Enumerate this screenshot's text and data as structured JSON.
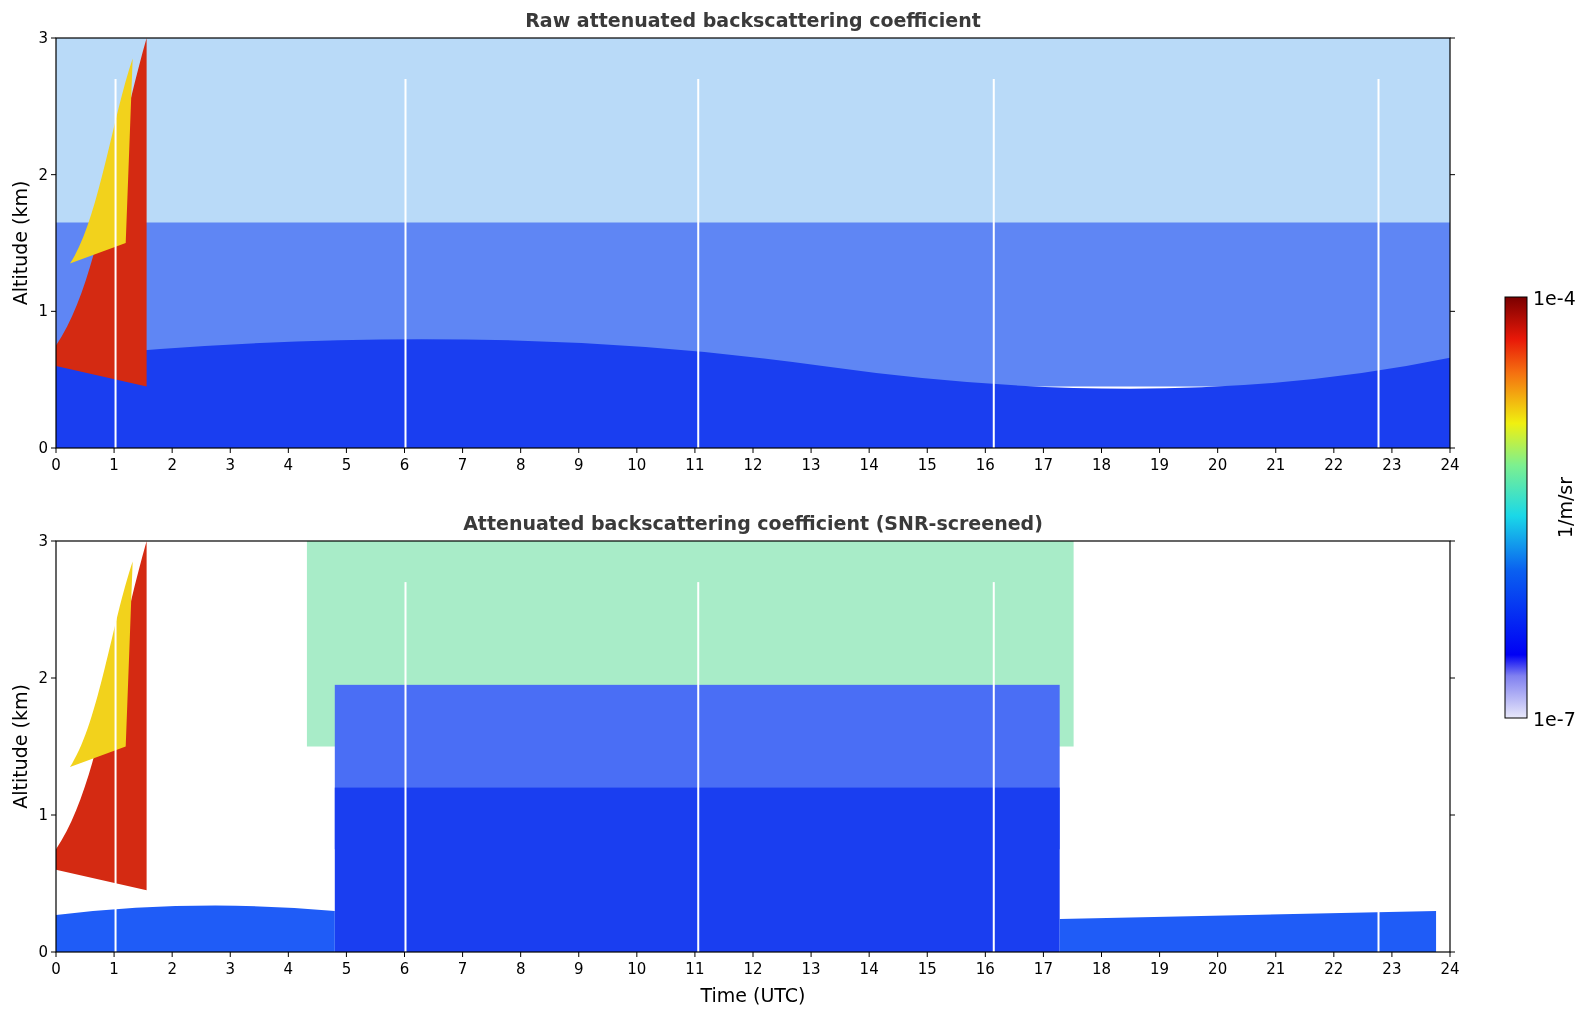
{
  "panels": [
    {
      "title": "Raw attenuated backscattering coefficient",
      "ylabel": "Altitude (km)",
      "yticks": [
        "3",
        "2",
        "1",
        "0"
      ],
      "xticks": [
        "0",
        "1",
        "2",
        "3",
        "4",
        "5",
        "6",
        "7",
        "8",
        "9",
        "10",
        "11",
        "12",
        "13",
        "14",
        "15",
        "16",
        "17",
        "18",
        "19",
        "20",
        "21",
        "22",
        "23",
        "24"
      ]
    },
    {
      "title": "Attenuated backscattering coefficient (SNR-screened)",
      "ylabel": "Altitude (km)",
      "yticks": [
        "3",
        "2",
        "1",
        "0"
      ],
      "xticks": [
        "0",
        "1",
        "2",
        "3",
        "4",
        "5",
        "6",
        "7",
        "8",
        "9",
        "10",
        "11",
        "12",
        "13",
        "14",
        "15",
        "16",
        "17",
        "18",
        "19",
        "20",
        "21",
        "22",
        "23",
        "24"
      ],
      "xlabel": "Time (UTC)"
    }
  ],
  "colorbar": {
    "top_label": "1e-4",
    "bottom_label": "1e-7",
    "label": "1/m/sr"
  }
}
